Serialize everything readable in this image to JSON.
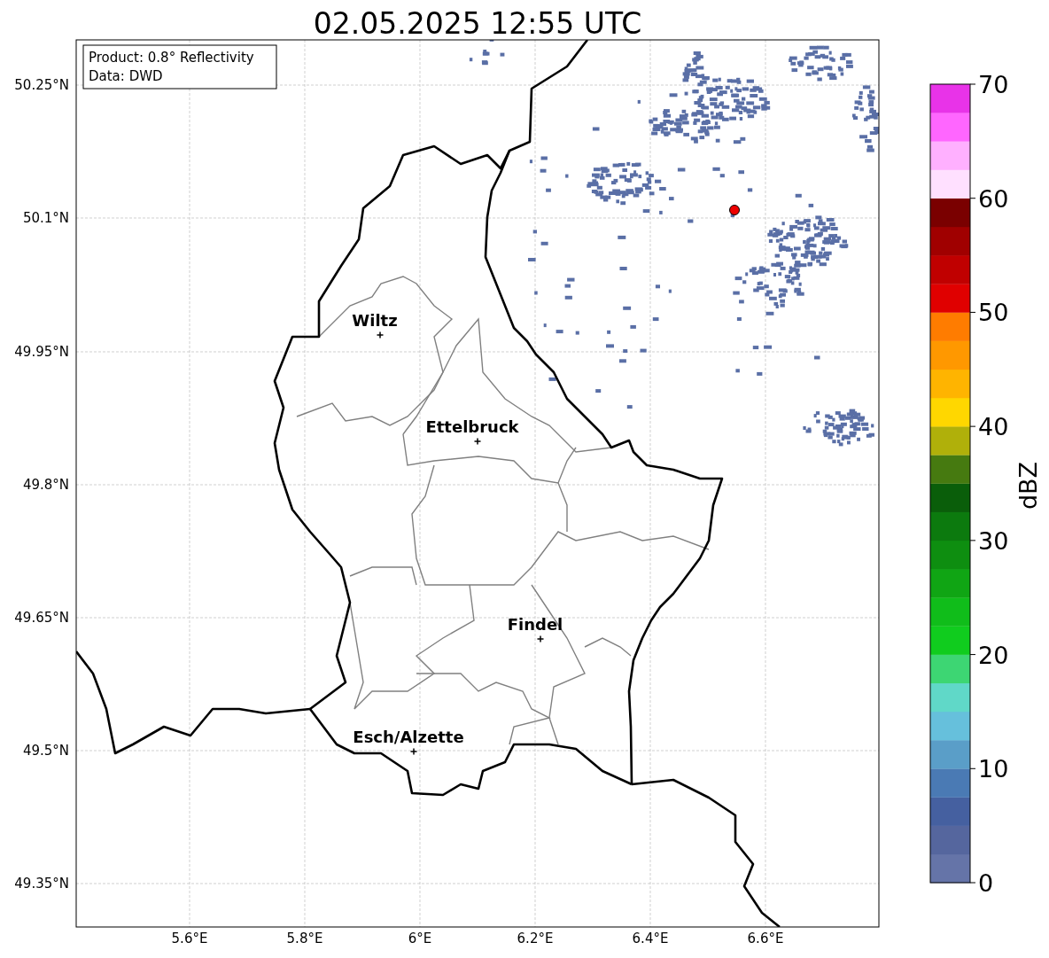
{
  "title": "02.05.2025 12:55 UTC",
  "info_box": [
    "Product: 0.8° Reflectivity",
    "Data: DWD"
  ],
  "y_ticks": [
    "50.25°N",
    "50.1°N",
    "49.95°N",
    "49.8°N",
    "49.65°N",
    "49.5°N",
    "49.35°N"
  ],
  "x_ticks": [
    "5.6°E",
    "5.8°E",
    "6°E",
    "6.2°E",
    "6.4°E",
    "6.6°E"
  ],
  "cities": [
    {
      "name": "Wiltz"
    },
    {
      "name": "Ettelbruck"
    },
    {
      "name": "Findel"
    },
    {
      "name": "Esch/Alzette"
    }
  ],
  "colorbar": {
    "label": "dBZ",
    "ticks": [
      "70",
      "60",
      "50",
      "40",
      "30",
      "20",
      "10",
      "0"
    ],
    "bins": [
      {
        "color": "#6574a8"
      },
      {
        "color": "#55669e"
      },
      {
        "color": "#4560a0"
      },
      {
        "color": "#4a7ab4"
      },
      {
        "color": "#5a9ec8"
      },
      {
        "color": "#66c0dc"
      },
      {
        "color": "#60d8c8"
      },
      {
        "color": "#3dd673"
      },
      {
        "color": "#10cc1e"
      },
      {
        "color": "#10bd1a"
      },
      {
        "color": "#10a514"
      },
      {
        "color": "#0e8e10"
      },
      {
        "color": "#0c7a0e"
      },
      {
        "color": "#0a5e0a"
      },
      {
        "color": "#467a10"
      },
      {
        "color": "#b0b00a"
      },
      {
        "color": "#ffd700"
      },
      {
        "color": "#ffb400"
      },
      {
        "color": "#ff9800"
      },
      {
        "color": "#ff7c00"
      },
      {
        "color": "#e00000"
      },
      {
        "color": "#c00000"
      },
      {
        "color": "#a00000"
      },
      {
        "color": "#7a0000"
      },
      {
        "color": "#ffe0ff"
      },
      {
        "color": "#ffb0ff"
      },
      {
        "color": "#ff66ff"
      },
      {
        "color": "#e833e8"
      }
    ]
  }
}
